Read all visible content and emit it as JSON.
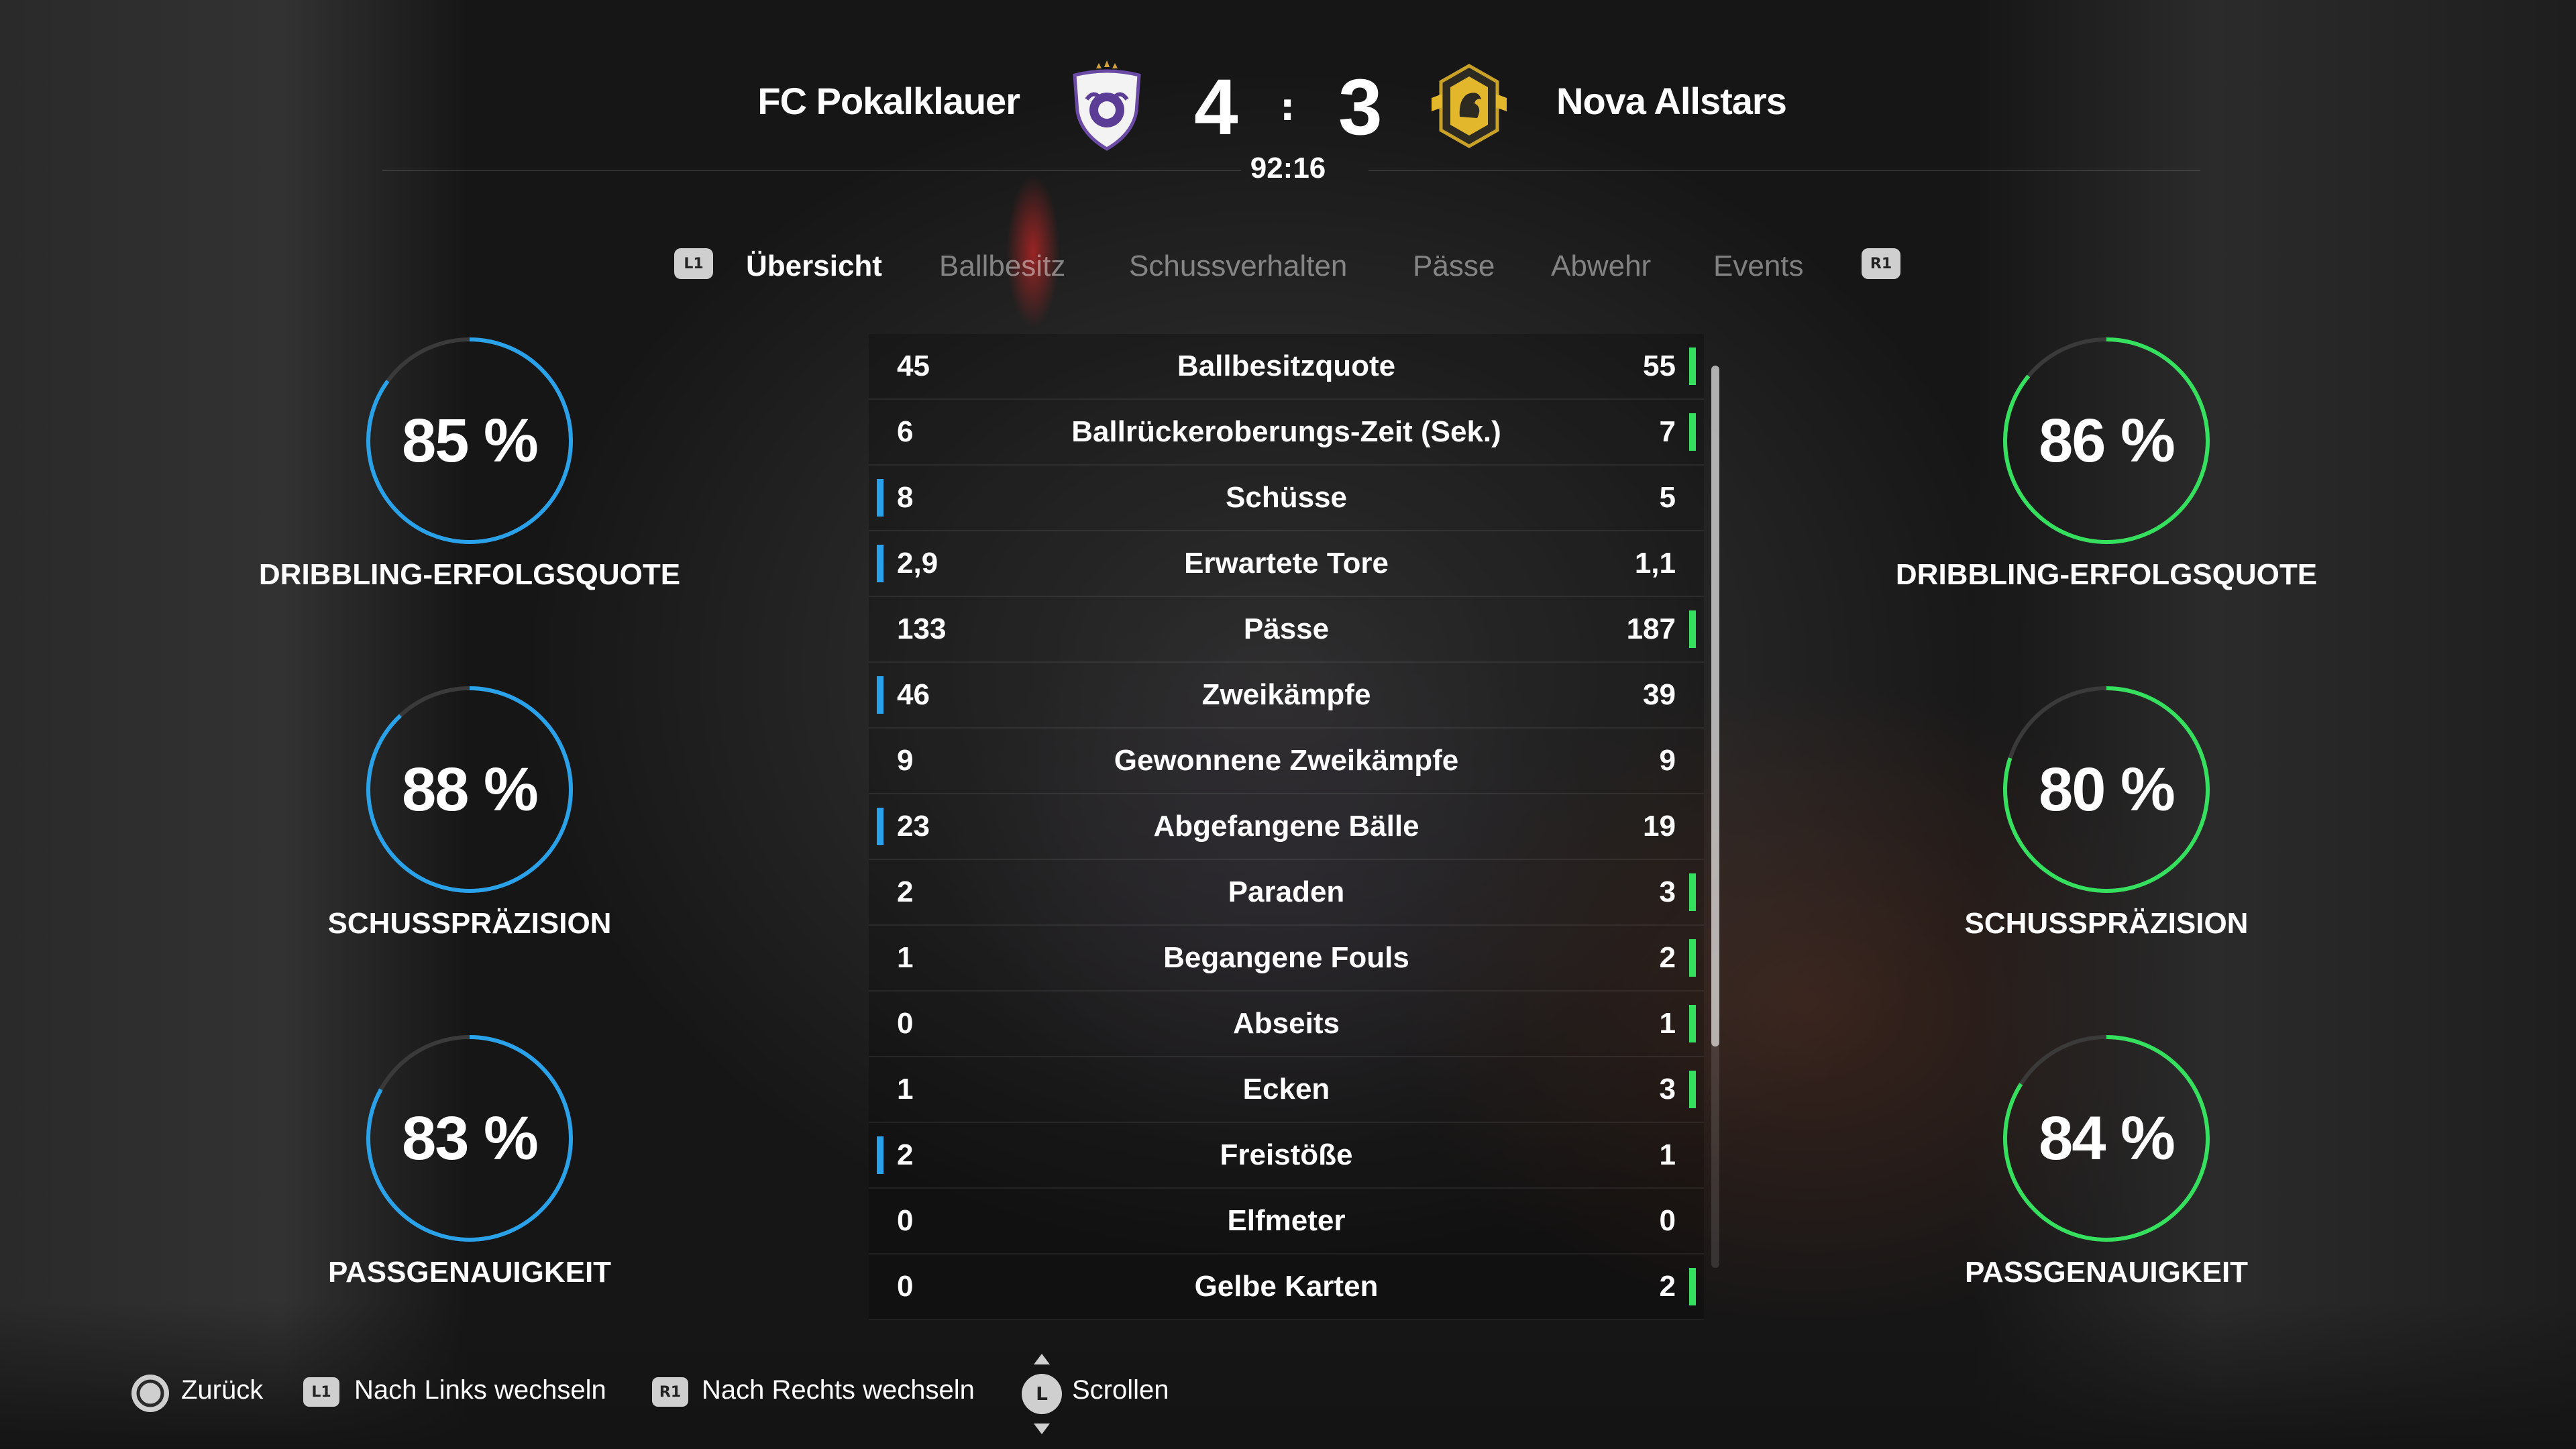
{
  "match": {
    "home_team": "FC Pokalklauer",
    "away_team": "Nova Allstars",
    "home_score": "4",
    "away_score": "3",
    "separator": ":",
    "time": "92:16"
  },
  "tabs": {
    "left_button": "L1",
    "right_button": "R1",
    "items": [
      "Übersicht",
      "Ballbesitz",
      "Schussverhalten",
      "Pässe",
      "Abwehr",
      "Events"
    ],
    "active_index": 0
  },
  "stats": [
    {
      "home": "45",
      "label": "Ballbesitzquote",
      "away": "55",
      "leader": "away"
    },
    {
      "home": "6",
      "label": "Ballrückeroberungs-Zeit (Sek.)",
      "away": "7",
      "leader": "away"
    },
    {
      "home": "8",
      "label": "Schüsse",
      "away": "5",
      "leader": "home"
    },
    {
      "home": "2,9",
      "label": "Erwartete Tore",
      "away": "1,1",
      "leader": "home"
    },
    {
      "home": "133",
      "label": "Pässe",
      "away": "187",
      "leader": "away"
    },
    {
      "home": "46",
      "label": "Zweikämpfe",
      "away": "39",
      "leader": "home"
    },
    {
      "home": "9",
      "label": "Gewonnene Zweikämpfe",
      "away": "9",
      "leader": "none"
    },
    {
      "home": "23",
      "label": "Abgefangene Bälle",
      "away": "19",
      "leader": "home"
    },
    {
      "home": "2",
      "label": "Paraden",
      "away": "3",
      "leader": "away"
    },
    {
      "home": "1",
      "label": "Begangene Fouls",
      "away": "2",
      "leader": "away"
    },
    {
      "home": "0",
      "label": "Abseits",
      "away": "1",
      "leader": "away"
    },
    {
      "home": "1",
      "label": "Ecken",
      "away": "3",
      "leader": "away"
    },
    {
      "home": "2",
      "label": "Freistöße",
      "away": "1",
      "leader": "home"
    },
    {
      "home": "0",
      "label": "Elfmeter",
      "away": "0",
      "leader": "none"
    },
    {
      "home": "0",
      "label": "Gelbe Karten",
      "away": "2",
      "leader": "away"
    }
  ],
  "home_rings": [
    {
      "value": "85 %",
      "fraction": 0.85,
      "label": "DRIBBLING-ERFOLGSQUOTE"
    },
    {
      "value": "88 %",
      "fraction": 0.88,
      "label": "SCHUSSPRÄZISION"
    },
    {
      "value": "83 %",
      "fraction": 0.83,
      "label": "PASSGENAUIGKEIT"
    }
  ],
  "away_rings": [
    {
      "value": "86 %",
      "fraction": 0.86,
      "label": "DRIBBLING-ERFOLGSQUOTE"
    },
    {
      "value": "80 %",
      "fraction": 0.8,
      "label": "SCHUSSPRÄZISION"
    },
    {
      "value": "84 %",
      "fraction": 0.84,
      "label": "PASSGENAUIGKEIT"
    }
  ],
  "colors": {
    "home_accent": "#2aa2ea",
    "away_accent": "#36e05f",
    "ring_track": "#3a3a3a"
  },
  "footer": {
    "back": "Zurück",
    "left_switch": "Nach Links wechseln",
    "right_switch": "Nach Rechts wechseln",
    "scroll": "Scrollen",
    "l1_label": "L1",
    "r1_label": "R1",
    "stick_label": "L"
  }
}
